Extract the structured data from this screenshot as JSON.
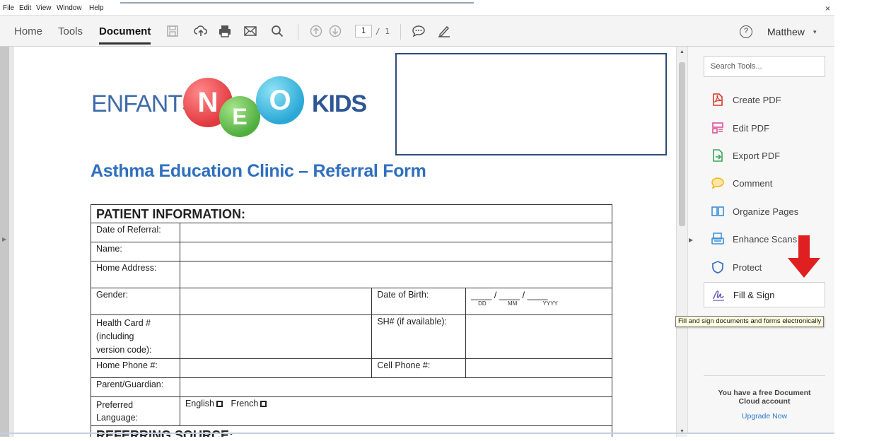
{
  "menu": {
    "items": [
      "File",
      "Edit",
      "View",
      "Window",
      "Help"
    ],
    "close": "×"
  },
  "toolbar": {
    "tabs": [
      "Home",
      "Tools",
      "Document"
    ],
    "page_current": "1",
    "page_total": "/ 1",
    "help": "?",
    "user": "Matthew",
    "user_caret": "▾"
  },
  "document": {
    "logo": {
      "left": "ENFANTS",
      "ball1": "N",
      "ball2": "E",
      "ball3": "O",
      "right": "KIDS"
    },
    "title": "Asthma Education Clinic – Referral Form",
    "section_patient": "PATIENT INFORMATION:",
    "fields": {
      "date_of_referral": "Date of Referral:",
      "name": "Name:",
      "home_address": "Home Address:",
      "gender": "Gender:",
      "date_of_birth": "Date of Birth:",
      "dob_slots": "____ / ____ / ____",
      "dob_dd": "DD",
      "dob_mm": "MM",
      "dob_yyyy": "YYYY",
      "health_card": "Health Card #",
      "health_card_2": "(including",
      "health_card_3": "version code):",
      "sh_number": "SH# (if available):",
      "home_phone": "Home Phone #:",
      "cell_phone": "Cell Phone #:",
      "parent_guardian": "Parent/Guardian:",
      "preferred": "Preferred",
      "language": "Language:",
      "english": "English",
      "french": "French"
    },
    "section_referring": "REFERRING SOURCE:"
  },
  "tools_panel": {
    "search_placeholder": "Search Tools...",
    "items": [
      {
        "label": "Create PDF",
        "icon": "create-pdf-icon",
        "color": "#d9372b"
      },
      {
        "label": "Edit PDF",
        "icon": "edit-pdf-icon",
        "color": "#e0509b"
      },
      {
        "label": "Export PDF",
        "icon": "export-pdf-icon",
        "color": "#3aa65a"
      },
      {
        "label": "Comment",
        "icon": "comment-icon",
        "color": "#f2b418"
      },
      {
        "label": "Organize Pages",
        "icon": "organize-pages-icon",
        "color": "#3a8fd6"
      },
      {
        "label": "Enhance Scans",
        "icon": "enhance-scans-icon",
        "color": "#3a8fd6"
      },
      {
        "label": "Protect",
        "icon": "protect-icon",
        "color": "#3a6fc0"
      },
      {
        "label": "Fill & Sign",
        "icon": "fill-sign-icon",
        "color": "#6c5ab8"
      }
    ],
    "promo_line1": "You have a free Document",
    "promo_line2": "Cloud account",
    "upgrade": "Upgrade Now"
  },
  "tooltip": "Fill and sign documents and forms electronically",
  "annotation": {
    "arrow_color": "#e02020"
  }
}
